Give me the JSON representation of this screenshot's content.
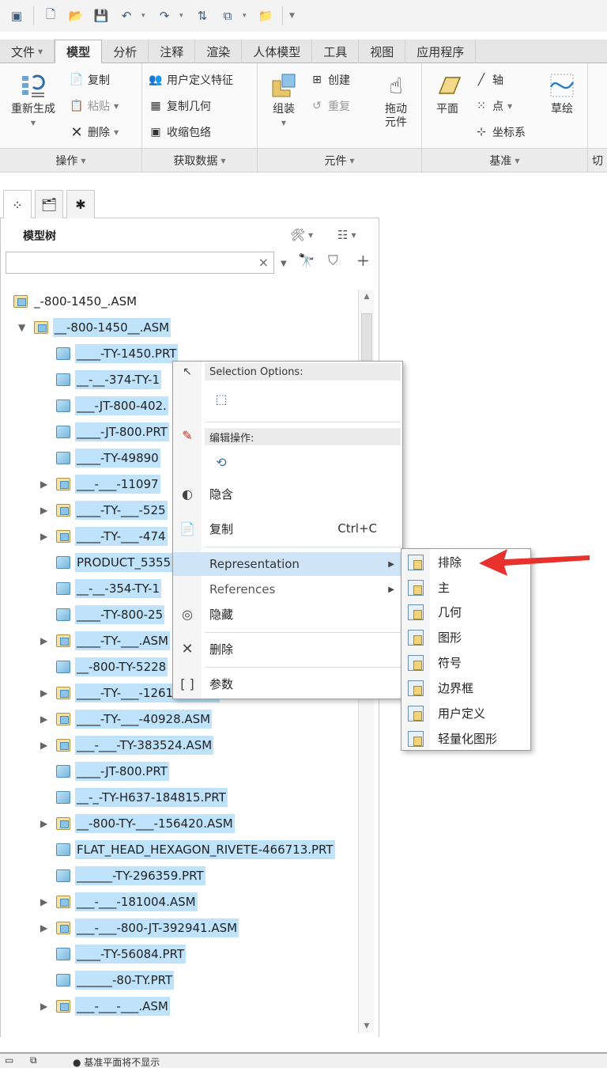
{
  "tabs": [
    "文件",
    "模型",
    "分析",
    "注释",
    "渲染",
    "人体模型",
    "工具",
    "视图",
    "应用程序"
  ],
  "ribbon": {
    "regenerate": "重新生成",
    "copy": "复制",
    "paste": "粘贴",
    "delete": "删除",
    "user_defined_feature": "用户定义特征",
    "copy_geometry": "复制几何",
    "shrinkwrap": "收缩包络",
    "assemble": "组装",
    "create": "创建",
    "repeat": "重复",
    "drag_component_l1": "拖动",
    "drag_component_l2": "元件",
    "plane": "平面",
    "axis": "轴",
    "point": "点",
    "coord_sys": "坐标系",
    "sketch": "草绘"
  },
  "group_labels": [
    "操作",
    "获取数据",
    "元件",
    "基准",
    "切"
  ],
  "panel": {
    "title": "模型树"
  },
  "tree": [
    {
      "name": "_-800-1450_.ASM",
      "type": "asm",
      "indent": 0,
      "expander": "",
      "selected": false
    },
    {
      "name": "__-800-1450__.ASM",
      "type": "asm",
      "indent": 1,
      "expander": "▼",
      "selected": true
    },
    {
      "name": "____-TY-1450.PRT",
      "type": "part",
      "indent": 2,
      "expander": "",
      "selected": true
    },
    {
      "name": "__-__-374-TY-1",
      "type": "part",
      "indent": 2,
      "expander": "",
      "selected": true
    },
    {
      "name": "___-JT-800-402.",
      "type": "part",
      "indent": 2,
      "expander": "",
      "selected": true
    },
    {
      "name": "____-JT-800.PRT",
      "type": "part",
      "indent": 2,
      "expander": "",
      "selected": true
    },
    {
      "name": "____-TY-49890",
      "type": "part",
      "indent": 2,
      "expander": "",
      "selected": true
    },
    {
      "name": "___-___-11097",
      "type": "asm",
      "indent": 2,
      "expander": "▶",
      "selected": true
    },
    {
      "name": "____-TY-___-525",
      "type": "asm",
      "indent": 2,
      "expander": "▶",
      "selected": true
    },
    {
      "name": "____-TY-___-474",
      "type": "asm",
      "indent": 2,
      "expander": "▶",
      "selected": true
    },
    {
      "name": "PRODUCT_5355",
      "type": "part",
      "indent": 2,
      "expander": "",
      "selected": true
    },
    {
      "name": "__-__-354-TY-1",
      "type": "part",
      "indent": 2,
      "expander": "",
      "selected": true
    },
    {
      "name": "____-TY-800-25",
      "type": "part",
      "indent": 2,
      "expander": "",
      "selected": true
    },
    {
      "name": "____-TY-___.ASM",
      "type": "asm",
      "indent": 2,
      "expander": "▶",
      "selected": true
    },
    {
      "name": "__-800-TY-5228",
      "type": "part",
      "indent": 2,
      "expander": "",
      "selected": true
    },
    {
      "name": "____-TY-___-126143.ASM",
      "type": "asm",
      "indent": 2,
      "expander": "▶",
      "selected": true
    },
    {
      "name": "____-TY-___-40928.ASM",
      "type": "asm",
      "indent": 2,
      "expander": "▶",
      "selected": true
    },
    {
      "name": "___-___-TY-383524.ASM",
      "type": "asm",
      "indent": 2,
      "expander": "▶",
      "selected": true
    },
    {
      "name": "____-JT-800.PRT",
      "type": "part",
      "indent": 2,
      "expander": "",
      "selected": true
    },
    {
      "name": "__-_-TY-H637-184815.PRT",
      "type": "part",
      "indent": 2,
      "expander": "",
      "selected": true
    },
    {
      "name": "__-800-TY-___-156420.ASM",
      "type": "asm",
      "indent": 2,
      "expander": "▶",
      "selected": true
    },
    {
      "name": "FLAT_HEAD_HEXAGON_RIVETE-466713.PRT",
      "type": "part",
      "indent": 2,
      "expander": "",
      "selected": true
    },
    {
      "name": "______-TY-296359.PRT",
      "type": "part",
      "indent": 2,
      "expander": "",
      "selected": true
    },
    {
      "name": "___-___-181004.ASM",
      "type": "asm",
      "indent": 2,
      "expander": "▶",
      "selected": true
    },
    {
      "name": "___-___-800-JT-392941.ASM",
      "type": "asm",
      "indent": 2,
      "expander": "▶",
      "selected": true
    },
    {
      "name": "____-TY-56084.PRT",
      "type": "part",
      "indent": 2,
      "expander": "",
      "selected": true
    },
    {
      "name": "______-80-TY.PRT",
      "type": "part",
      "indent": 2,
      "expander": "",
      "selected": true
    },
    {
      "name": "___-___-___.ASM",
      "type": "asm",
      "indent": 2,
      "expander": "▶",
      "selected": true
    }
  ],
  "context_menu": {
    "selection_options": "Selection Options:",
    "edit_ops": "编辑操作:",
    "hide": "隐含",
    "copy": "复制",
    "copy_shortcut": "Ctrl+C",
    "representation": "Representation",
    "references": "References",
    "hide2": "隐藏",
    "delete": "删除",
    "params": "参数"
  },
  "submenu": [
    "排除",
    "主",
    "几何",
    "图形",
    "符号",
    "边界框",
    "用户定义",
    "轻量化图形"
  ],
  "status": {
    "message": "● 基准平面将不显示"
  },
  "colors": {
    "selection": "#bfe3fb",
    "menu_highlight": "#cfe5f7",
    "arrow": "#e8302c"
  }
}
